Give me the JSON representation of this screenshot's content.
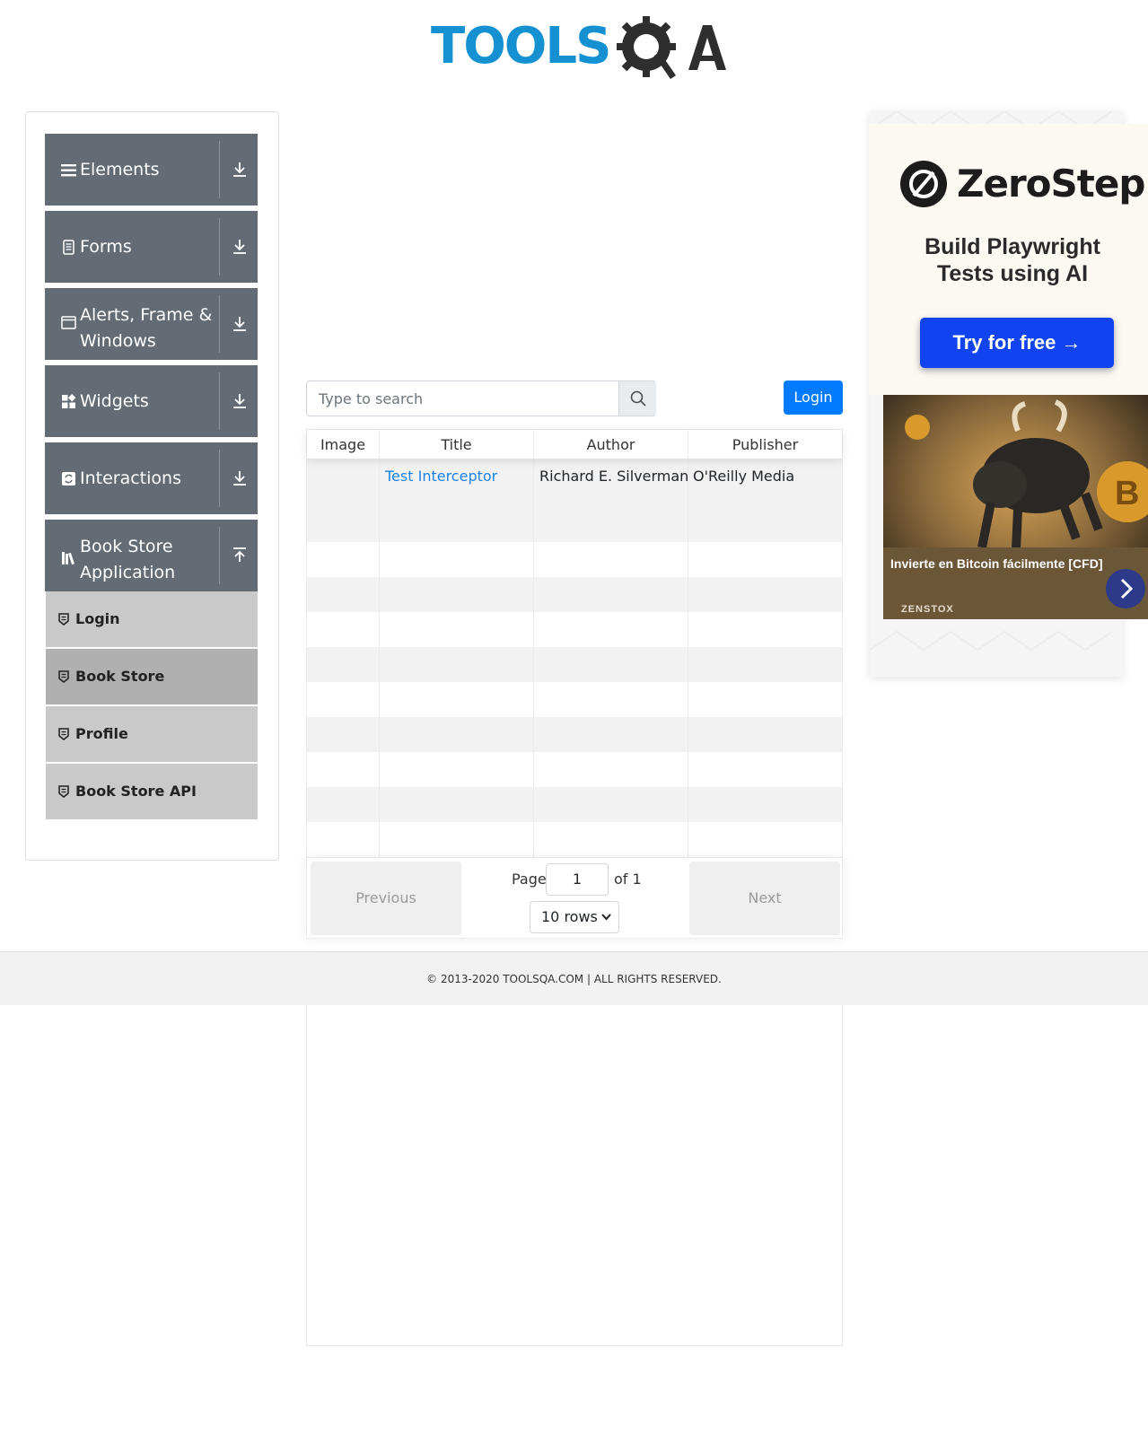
{
  "brand": {
    "logo_text": "TOOLSQA"
  },
  "sidebar": {
    "groups": [
      {
        "label": "Elements",
        "icon": "hamburger-icon",
        "expanded": false
      },
      {
        "label": "Forms",
        "icon": "document-icon",
        "expanded": false
      },
      {
        "label": "Alerts, Frame & Windows",
        "icon": "window-icon",
        "expanded": false
      },
      {
        "label": "Widgets",
        "icon": "widgets-icon",
        "expanded": false
      },
      {
        "label": "Interactions",
        "icon": "interactions-icon",
        "expanded": false
      },
      {
        "label": "Book Store Application",
        "icon": "books-icon",
        "expanded": true
      }
    ],
    "bookstore_items": [
      {
        "label": "Login",
        "active": false
      },
      {
        "label": "Book Store",
        "active": true
      },
      {
        "label": "Profile",
        "active": false
      },
      {
        "label": "Book Store API",
        "active": false
      }
    ]
  },
  "search": {
    "placeholder": "Type to search"
  },
  "login_button": "Login",
  "table": {
    "headers": [
      "Image",
      "Title",
      "Author",
      "Publisher"
    ],
    "rows": [
      {
        "image": "",
        "title": "Test Interceptor",
        "author": "Richard E. Silverman",
        "publisher": "O'Reilly Media"
      }
    ]
  },
  "pagination": {
    "previous": "Previous",
    "next": "Next",
    "page_label": "Page",
    "current_page": "1",
    "of_label": "of 1",
    "rows_option": "10 rows"
  },
  "footer": {
    "text": "© 2013-2020 TOOLSQA.COM | ALL RIGHTS RESERVED."
  },
  "ad": {
    "brand": "ZeroStep",
    "headline": "Build Playwright Tests using AI",
    "cta": "Try for free →",
    "caption": "Invierte en Bitcoin fácilmente [CFD]",
    "source": "ZENSTOX"
  },
  "colors": {
    "sidebar_group": "#636b75",
    "sub_item": "#c9c9c9",
    "sub_item_active": "#b0b0b0",
    "primary": "#007bff",
    "link": "#1b82e6",
    "logo_blue": "#1591d2",
    "ad_cta": "#1144ee"
  }
}
